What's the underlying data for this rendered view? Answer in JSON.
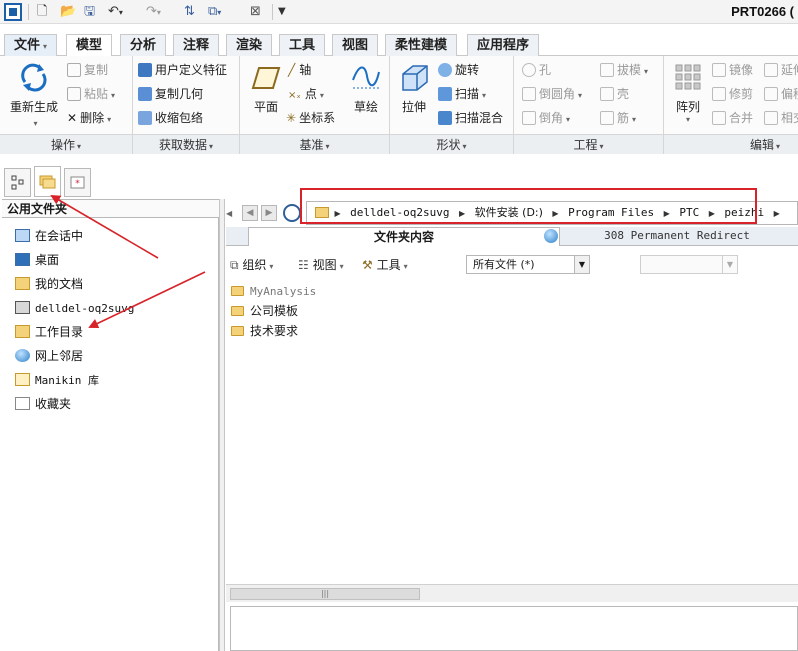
{
  "window": {
    "title": "PRT0266 ("
  },
  "ribbon_tabs": [
    "文件",
    "模型",
    "分析",
    "注释",
    "渲染",
    "工具",
    "视图",
    "柔性建模",
    "应用程序"
  ],
  "ribbon": {
    "ops": {
      "regen": "重新生成",
      "copy": "复制",
      "paste": "粘贴",
      "delete": "删除",
      "label": "操作"
    },
    "get": {
      "udf": "用户定义特征",
      "copygeom": "复制几何",
      "shrink": "收缩包络",
      "label": "获取数据"
    },
    "datum": {
      "plane": "平面",
      "axis": "轴",
      "point": "点",
      "csys": "坐标系",
      "sketch": "草绘",
      "label": "基准"
    },
    "shape": {
      "extrude": "拉伸",
      "revolve": "旋转",
      "sweep": "扫描",
      "blend": "扫描混合",
      "label": "形状"
    },
    "eng": {
      "hole": "孔",
      "round": "倒圆角",
      "chamfer": "倒角",
      "draft": "拔模",
      "shell": "壳",
      "rib": "筋",
      "label": "工程"
    },
    "edit": {
      "pattern": "阵列",
      "mirror": "镜像",
      "extend": "延伸",
      "trim": "修剪",
      "offset": "偏移",
      "merge": "合并",
      "intersect": "相交",
      "label": "编辑"
    }
  },
  "left_panel": {
    "title": "公用文件夹",
    "items": [
      "在会话中",
      "桌面",
      "我的文档",
      "delldel-oq2suvg",
      "工作目录",
      "网上邻居",
      "Manikin 库",
      "收藏夹"
    ]
  },
  "address": {
    "segments": [
      "delldel-oq2suvg",
      "软件安装 (D:)",
      "Program Files",
      "PTC",
      "peizhi"
    ]
  },
  "browser_tabs": {
    "active": "文件夹内容",
    "second": "308 Permanent Redirect"
  },
  "toolbar": {
    "organize": "组织",
    "view": "视图",
    "tools": "工具",
    "filter": "所有文件 (*)"
  },
  "files": [
    "MyAnalysis",
    "公司模板",
    "技术要求"
  ],
  "colors": {
    "accent": "#1b5fa8",
    "annotation": "#d8232a",
    "folder": "#f4d27a"
  }
}
